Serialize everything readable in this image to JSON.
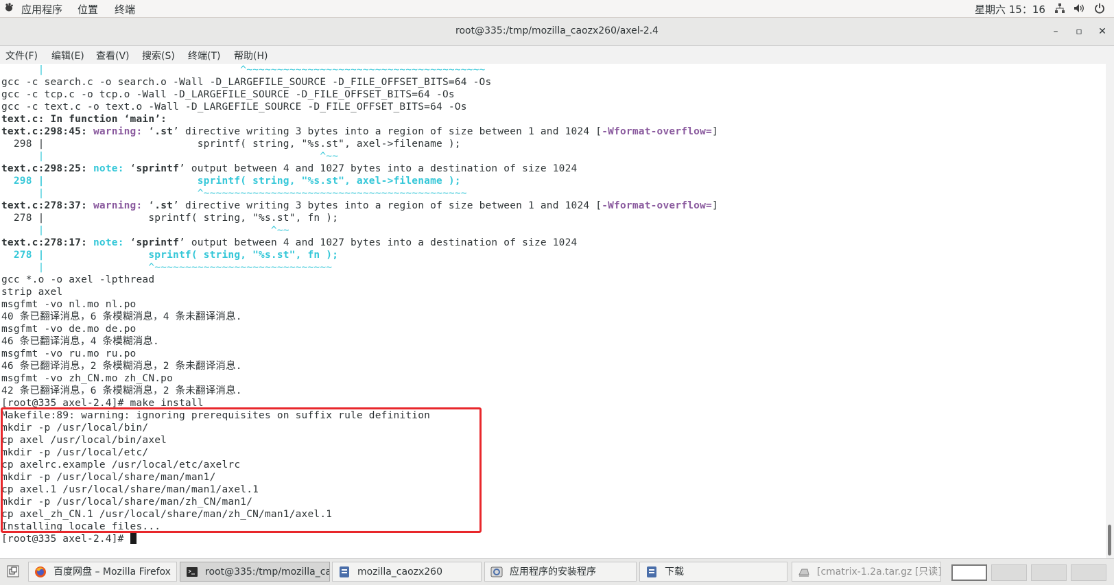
{
  "topbar": {
    "menus": [
      "应用程序",
      "位置",
      "终端"
    ],
    "clock": "星期六 15：16"
  },
  "window": {
    "title": "root@335:/tmp/mozilla_caozx260/axel-2.4",
    "buttons": {
      "minimize": "–",
      "maximize": "▫",
      "close": "✕"
    }
  },
  "menubar": [
    "文件(F)",
    "编辑(E)",
    "查看(V)",
    "搜索(S)",
    "终端(T)",
    "帮助(H)"
  ],
  "terminal": {
    "lines": [
      "      |                                ^~~~~~~~~~~~~~~~~~~~~~~~~~~~~~~~~~~~~~~~",
      "gcc -c search.c -o search.o -Wall -D_LARGEFILE_SOURCE -D_FILE_OFFSET_BITS=64 -Os",
      "gcc -c tcp.c -o tcp.o -Wall -D_LARGEFILE_SOURCE -D_FILE_OFFSET_BITS=64 -Os",
      "gcc -c text.c -o text.o -Wall -D_LARGEFILE_SOURCE -D_FILE_OFFSET_BITS=64 -Os",
      "text.c: In function ‘main’:",
      "text.c:298:45: warning: ‘.st’ directive writing 3 bytes into a region of size between 1 and 1024 [-Wformat-overflow=]",
      "  298 |                         sprintf( string, \"%s.st\", axel->filename );",
      "      |                                             ^~~",
      "text.c:298:25: note: ‘sprintf’ output between 4 and 1027 bytes into a destination of size 1024",
      "  298 |                         sprintf( string, \"%s.st\", axel->filename );",
      "      |                         ^~~~~~~~~~~~~~~~~~~~~~~~~~~~~~~~~~~~~~~~~~~~",
      "text.c:278:37: warning: ‘.st’ directive writing 3 bytes into a region of size between 1 and 1024 [-Wformat-overflow=]",
      "  278 |                 sprintf( string, \"%s.st\", fn );",
      "      |                                     ^~~",
      "text.c:278:17: note: ‘sprintf’ output between 4 and 1027 bytes into a destination of size 1024",
      "  278 |                 sprintf( string, \"%s.st\", fn );",
      "      |                 ^~~~~~~~~~~~~~~~~~~~~~~~~~~~~~",
      "gcc *.o -o axel -lpthread",
      "strip axel",
      "msgfmt -vo nl.mo nl.po",
      "40 条已翻译消息，6 条模糊消息，4 条未翻译消息.",
      "msgfmt -vo de.mo de.po",
      "46 条已翻译消息，4 条模糊消息.",
      "msgfmt -vo ru.mo ru.po",
      "46 条已翻译消息，2 条模糊消息，2 条未翻译消息.",
      "msgfmt -vo zh_CN.mo zh_CN.po",
      "42 条已翻译消息，6 条模糊消息，2 条未翻译消息.",
      "[root@335 axel-2.4]# make install",
      "Makefile:89: warning: ignoring prerequisites on suffix rule definition",
      "mkdir -p /usr/local/bin/",
      "cp axel /usr/local/bin/axel",
      "mkdir -p /usr/local/etc/",
      "cp axelrc.example /usr/local/etc/axelrc",
      "mkdir -p /usr/local/share/man/man1/",
      "cp axel.1 /usr/local/share/man/man1/axel.1",
      "mkdir -p /usr/local/share/man/zh_CN/man1/",
      "cp axel_zh_CN.1 /usr/local/share/man/zh_CN/man1/axel.1",
      "Installing locale files...",
      "[root@335 axel-2.4]# "
    ]
  },
  "taskbar": {
    "tasks": [
      {
        "label": "百度网盘 – Mozilla Firefox",
        "icon": "firefox-icon"
      },
      {
        "label": "root@335:/tmp/mozilla_ca···",
        "icon": "terminal-icon"
      },
      {
        "label": "mozilla_caozx260",
        "icon": "file-manager-icon"
      },
      {
        "label": "应用程序的安装程序",
        "icon": "software-installer-icon"
      },
      {
        "label": "下载",
        "icon": "file-manager-icon"
      },
      {
        "label": "[cmatrix-1.2a.tar.gz [只读]]",
        "icon": "archive-icon"
      }
    ]
  },
  "colors": {
    "warning": "#8a5a9e",
    "note": "#34c7d8",
    "highlight_box": "#e8272b"
  }
}
